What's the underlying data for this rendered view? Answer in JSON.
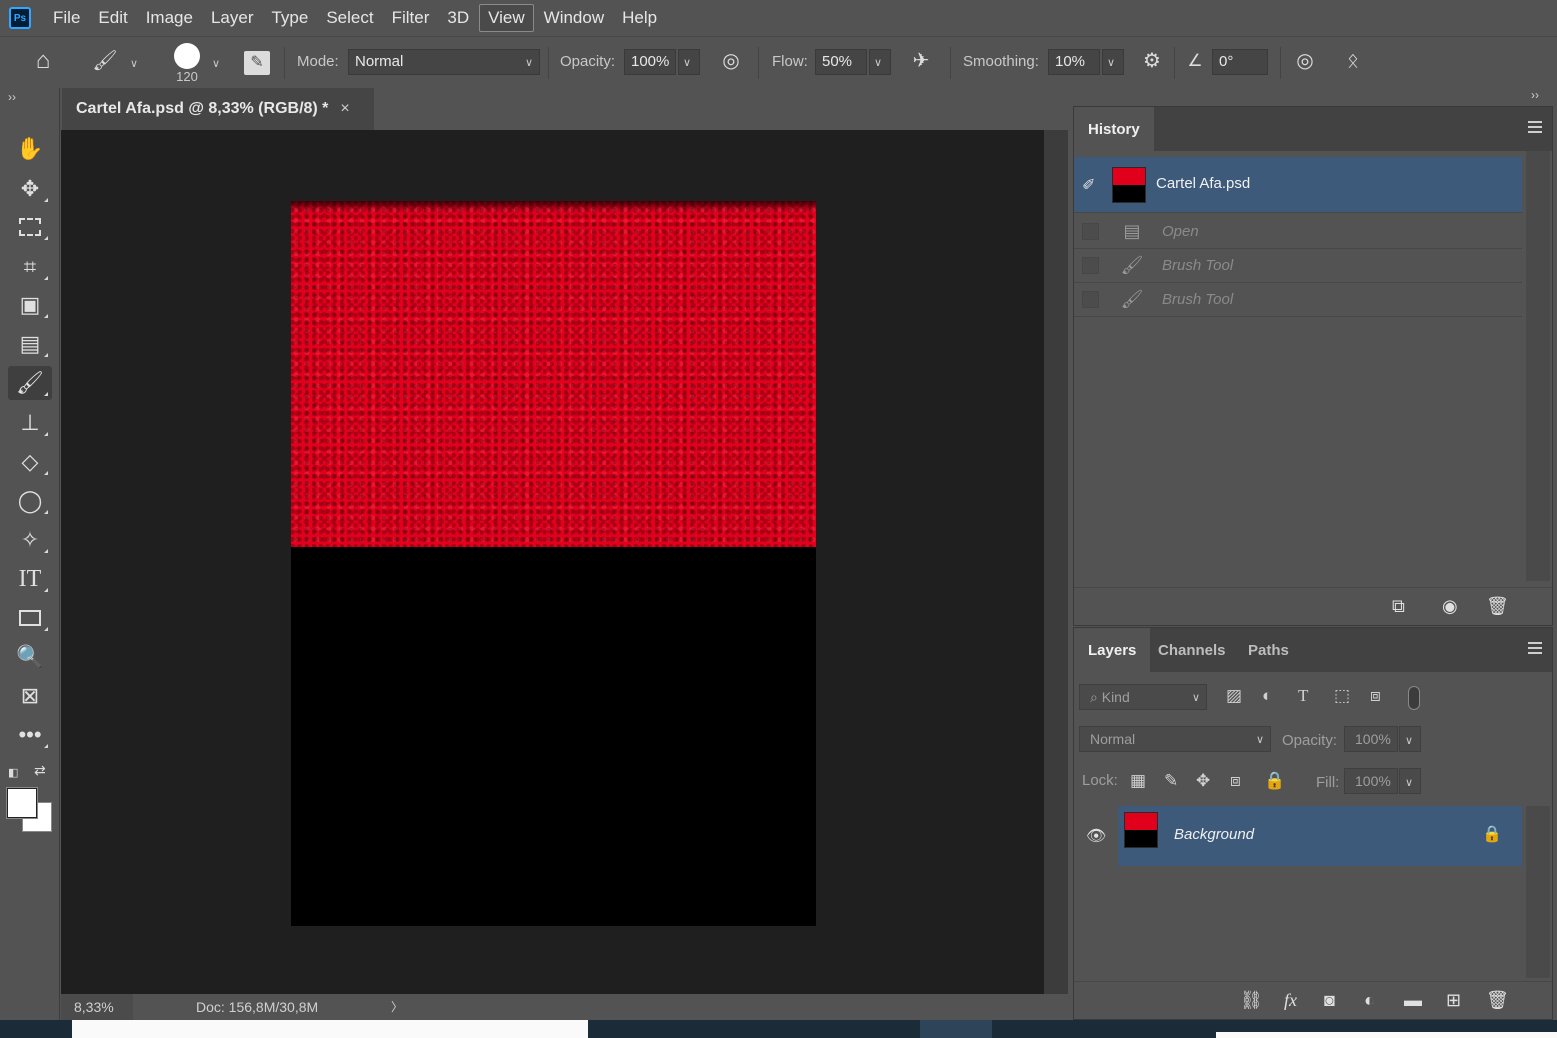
{
  "app": {
    "logo_text": "Ps",
    "menus": [
      "File",
      "Edit",
      "Image",
      "Layer",
      "Type",
      "Select",
      "Filter",
      "3D",
      "View",
      "Window",
      "Help"
    ],
    "active_menu": "View"
  },
  "options_bar": {
    "brush_size": "120",
    "mode_label": "Mode:",
    "mode_value": "Normal",
    "opacity_label": "Opacity:",
    "opacity_value": "100%",
    "flow_label": "Flow:",
    "flow_value": "50%",
    "smoothing_label": "Smoothing:",
    "smoothing_value": "10%",
    "angle_value": "0°"
  },
  "document": {
    "tab_title": "Cartel Afa.psd @ 8,33% (RGB/8) *",
    "close_glyph": "×",
    "zoom": "8,33%",
    "doc_info": "Doc: 156,8M/30,8M",
    "status_arrow": "〉"
  },
  "colors": {
    "canvas_red": "#d9001a",
    "canvas_black": "#000000",
    "selection_blue": "#3d5a7a",
    "accent": "#31a8ff"
  },
  "history": {
    "tab_label": "History",
    "snapshot_label": "Cartel Afa.psd",
    "steps": [
      {
        "label": "Open",
        "icon": "document-icon"
      },
      {
        "label": "Brush Tool",
        "icon": "brush-icon"
      },
      {
        "label": "Brush Tool",
        "icon": "brush-icon"
      }
    ]
  },
  "layers": {
    "tabs": [
      "Layers",
      "Channels",
      "Paths"
    ],
    "active_tab": "Layers",
    "kind_label": "Kind",
    "blend_mode": "Normal",
    "opacity_label": "Opacity:",
    "opacity_value": "100%",
    "lock_label": "Lock:",
    "fill_label": "Fill:",
    "fill_value": "100%",
    "items": [
      {
        "name": "Background",
        "visible": true,
        "locked": true
      }
    ]
  },
  "tools": [
    "hand-tool",
    "move-tool",
    "marquee-tool",
    "crop-tool",
    "frame-tool",
    "healing-tool",
    "brush-tool",
    "stamp-tool",
    "eraser-tool",
    "lasso-tool",
    "magic-wand-tool",
    "type-tool",
    "rectangle-tool",
    "zoom-tool",
    "frame-x-tool",
    "more-tools"
  ],
  "selected_tool": "brush-tool"
}
